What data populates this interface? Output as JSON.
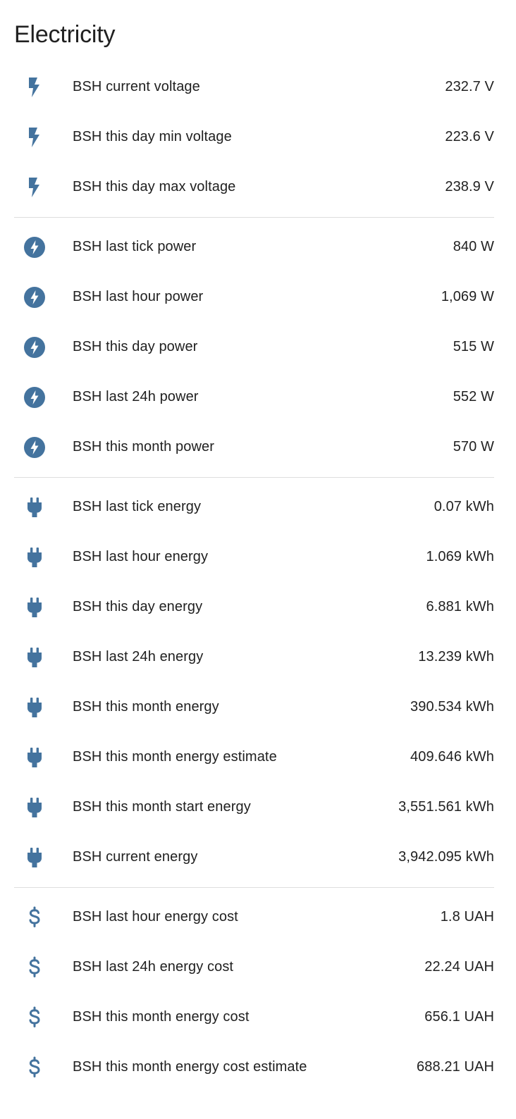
{
  "card": {
    "title": "Electricity",
    "icon_color": "#44739e",
    "divider_color": "#dedede"
  },
  "groups": [
    {
      "icon": "flash-icon",
      "rows": [
        {
          "label": "BSH current voltage",
          "value": "232.7 V"
        },
        {
          "label": "BSH this day min voltage",
          "value": "223.6 V"
        },
        {
          "label": "BSH this day max voltage",
          "value": "238.9 V"
        }
      ]
    },
    {
      "icon": "lightning-circle-icon",
      "rows": [
        {
          "label": "BSH last tick power",
          "value": "840 W"
        },
        {
          "label": "BSH last hour power",
          "value": "1,069 W"
        },
        {
          "label": "BSH this day power",
          "value": "515 W"
        },
        {
          "label": "BSH last 24h power",
          "value": "552 W"
        },
        {
          "label": "BSH this month power",
          "value": "570 W"
        }
      ]
    },
    {
      "icon": "power-plug-icon",
      "rows": [
        {
          "label": "BSH last tick energy",
          "value": "0.07 kWh"
        },
        {
          "label": "BSH last hour energy",
          "value": "1.069 kWh"
        },
        {
          "label": "BSH this day energy",
          "value": "6.881 kWh"
        },
        {
          "label": "BSH last 24h energy",
          "value": "13.239 kWh"
        },
        {
          "label": "BSH this month energy",
          "value": "390.534 kWh"
        },
        {
          "label": "BSH this month energy estimate",
          "value": "409.646 kWh"
        },
        {
          "label": "BSH this month start energy",
          "value": "3,551.561 kWh"
        },
        {
          "label": "BSH current energy",
          "value": "3,942.095 kWh"
        }
      ]
    },
    {
      "icon": "currency-usd-icon",
      "rows": [
        {
          "label": "BSH last hour energy cost",
          "value": "1.8 UAH"
        },
        {
          "label": "BSH last 24h energy cost",
          "value": "22.24 UAH"
        },
        {
          "label": "BSH this month energy cost",
          "value": "656.1 UAH"
        },
        {
          "label": "BSH this month energy cost estimate",
          "value": "688.21 UAH"
        }
      ]
    }
  ]
}
